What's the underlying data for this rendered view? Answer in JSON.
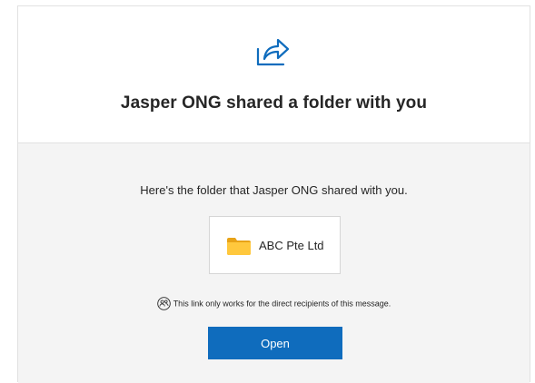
{
  "header": {
    "icon": "share-icon",
    "title": "Jasper ONG shared a folder with you"
  },
  "body": {
    "message": "Here's the folder that Jasper ONG shared with you.",
    "folder": {
      "icon": "folder-icon",
      "name": "ABC Pte Ltd"
    },
    "notice": {
      "icon": "people-restricted-icon",
      "text": "This link only works for the direct recipients of this message."
    },
    "open_button_label": "Open"
  },
  "colors": {
    "accent": "#0f6cbd",
    "folder": "#ffc83d",
    "body_background": "#f4f4f4"
  }
}
